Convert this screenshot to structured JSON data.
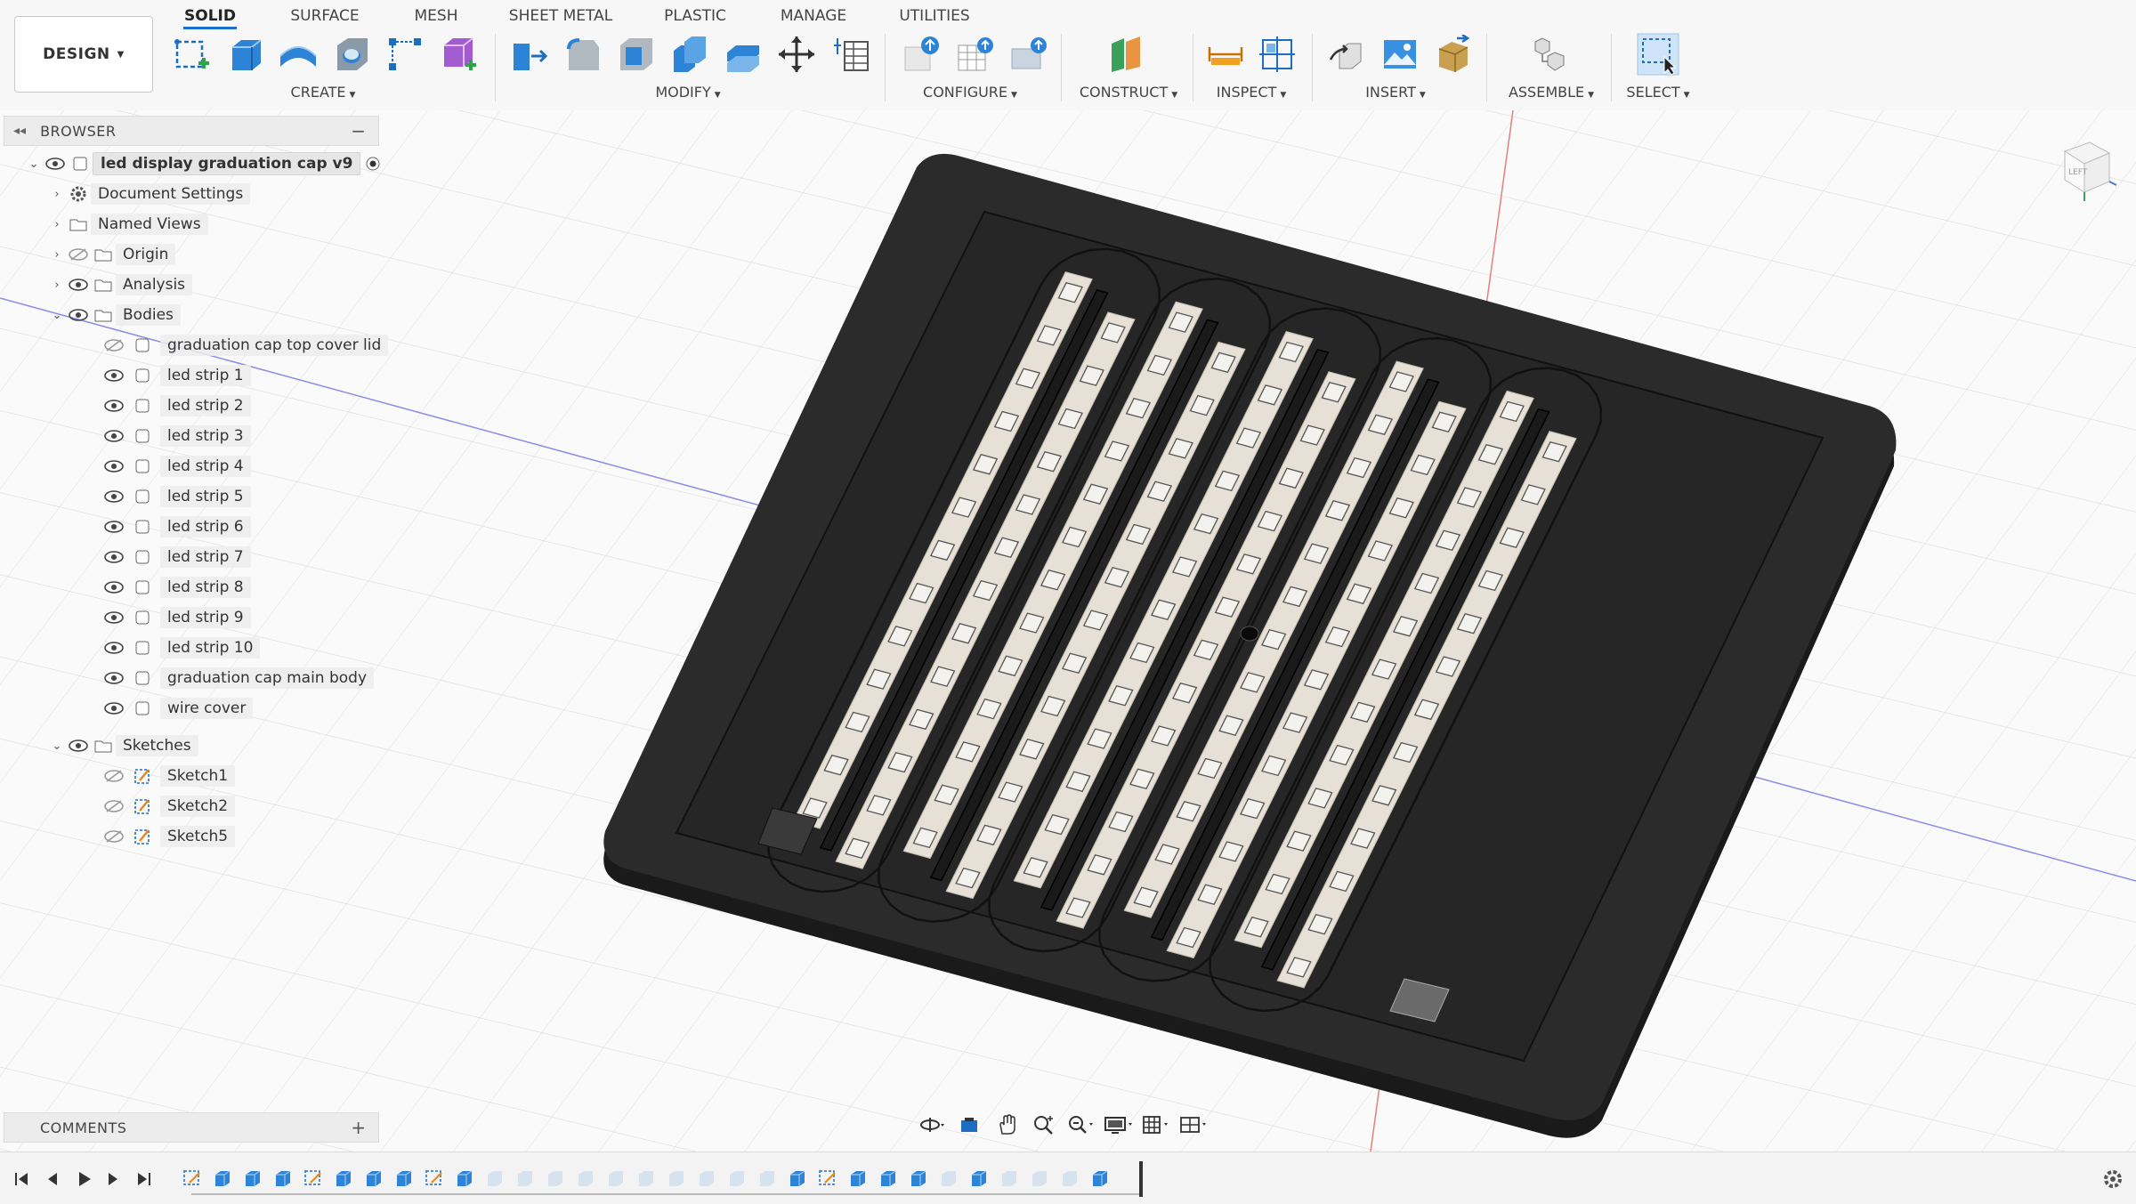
{
  "workspace": {
    "label": "DESIGN"
  },
  "tabs": [
    {
      "label": "SOLID",
      "active": true
    },
    {
      "label": "SURFACE"
    },
    {
      "label": "MESH"
    },
    {
      "label": "SHEET METAL"
    },
    {
      "label": "PLASTIC"
    },
    {
      "label": "MANAGE"
    },
    {
      "label": "UTILITIES"
    }
  ],
  "tool_groups": {
    "create": "CREATE",
    "modify": "MODIFY",
    "configure": "CONFIGURE",
    "construct": "CONSTRUCT",
    "inspect": "INSPECT",
    "insert": "INSERT",
    "assemble": "ASSEMBLE",
    "select": "SELECT"
  },
  "browser": {
    "title": "BROWSER",
    "root": "led display graduation cap v9",
    "items": {
      "document_settings": "Document Settings",
      "named_views": "Named Views",
      "origin": "Origin",
      "analysis": "Analysis",
      "bodies": "Bodies",
      "sketches": "Sketches"
    },
    "bodies": [
      {
        "label": "graduation cap top cover lid",
        "visible": false
      },
      {
        "label": "led strip 1",
        "visible": true
      },
      {
        "label": "led strip 2",
        "visible": true
      },
      {
        "label": "led strip 3",
        "visible": true
      },
      {
        "label": "led strip 4",
        "visible": true
      },
      {
        "label": "led strip 5",
        "visible": true
      },
      {
        "label": "led strip 6",
        "visible": true
      },
      {
        "label": "led strip 7",
        "visible": true
      },
      {
        "label": "led strip 8",
        "visible": true
      },
      {
        "label": "led strip 9",
        "visible": true
      },
      {
        "label": "led strip 10",
        "visible": true
      },
      {
        "label": "graduation cap main body",
        "visible": true
      },
      {
        "label": "wire cover",
        "visible": true
      }
    ],
    "sketches": [
      {
        "label": "Sketch1",
        "visible": false
      },
      {
        "label": "Sketch2",
        "visible": false
      },
      {
        "label": "Sketch5",
        "visible": false
      }
    ]
  },
  "comments": {
    "title": "COMMENTS"
  },
  "viewcube": {
    "face": "LEFT"
  },
  "colors": {
    "accent": "#1a6fd1",
    "model_body": "#2b2b2b",
    "led_strip": "#e6e0d6",
    "axis_red": "#e06060",
    "axis_blue": "#7070e0"
  }
}
